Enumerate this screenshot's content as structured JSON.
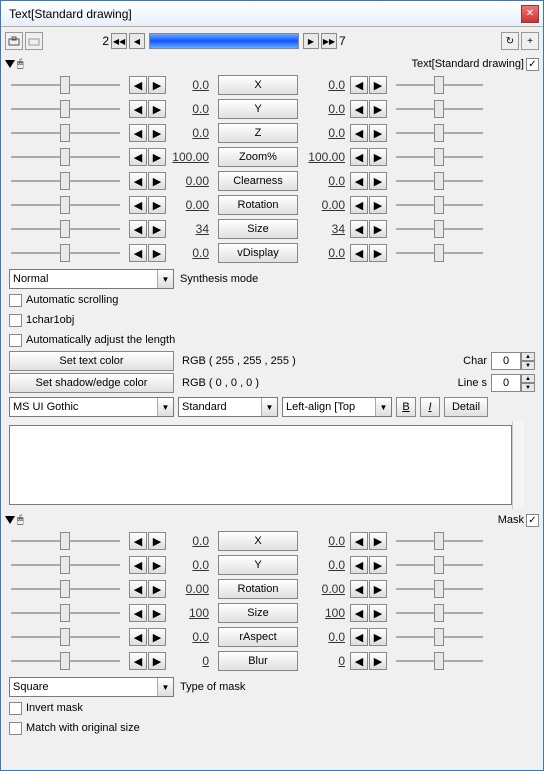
{
  "window": {
    "title": "Text[Standard drawing]"
  },
  "frame": {
    "current": "2",
    "total": "7"
  },
  "section1": {
    "label": "Text[Standard drawing]",
    "checked": "✓",
    "rows": [
      {
        "name": "X",
        "lv": "0.0",
        "rv": "0.0"
      },
      {
        "name": "Y",
        "lv": "0.0",
        "rv": "0.0"
      },
      {
        "name": "Z",
        "lv": "0.0",
        "rv": "0.0"
      },
      {
        "name": "Zoom%",
        "lv": "100.00",
        "rv": "100.00"
      },
      {
        "name": "Clearness",
        "lv": "0.00",
        "rv": "0.0"
      },
      {
        "name": "Rotation",
        "lv": "0.00",
        "rv": "0.00"
      },
      {
        "name": "Size",
        "lv": "34",
        "rv": "34"
      },
      {
        "name": "vDisplay",
        "lv": "0.0",
        "rv": "0.0"
      }
    ]
  },
  "synth": {
    "mode": "Normal",
    "label": "Synthesis mode"
  },
  "opts": {
    "auto_scroll": "Automatic scrolling",
    "char1obj": "1char1obj",
    "auto_len": "Automatically adjust the length"
  },
  "color": {
    "text_btn": "Set text color",
    "text_rgb": "RGB ( 255 , 255 , 255 )",
    "shadow_btn": "Set shadow/edge color",
    "shadow_rgb": "RGB ( 0 , 0 , 0 )"
  },
  "char_line": {
    "char_l": "Char",
    "char_v": "0",
    "line_l": "Line s",
    "line_v": "0"
  },
  "font": {
    "name": "MS UI Gothic",
    "style": "Standard",
    "align": "Left-align [Top"
  },
  "fmt": {
    "b": "B",
    "i": "I",
    "detail": "Detail"
  },
  "section2": {
    "label": "Mask",
    "checked": "✓",
    "rows": [
      {
        "name": "X",
        "lv": "0.0",
        "rv": "0.0"
      },
      {
        "name": "Y",
        "lv": "0.0",
        "rv": "0.0"
      },
      {
        "name": "Rotation",
        "lv": "0.00",
        "rv": "0.00"
      },
      {
        "name": "Size",
        "lv": "100",
        "rv": "100"
      },
      {
        "name": "rAspect",
        "lv": "0.0",
        "rv": "0.0"
      },
      {
        "name": "Blur",
        "lv": "0",
        "rv": "0"
      }
    ]
  },
  "mask": {
    "type": "Square",
    "label": "Type of mask",
    "invert": "Invert mask",
    "match": "Match with original size"
  }
}
